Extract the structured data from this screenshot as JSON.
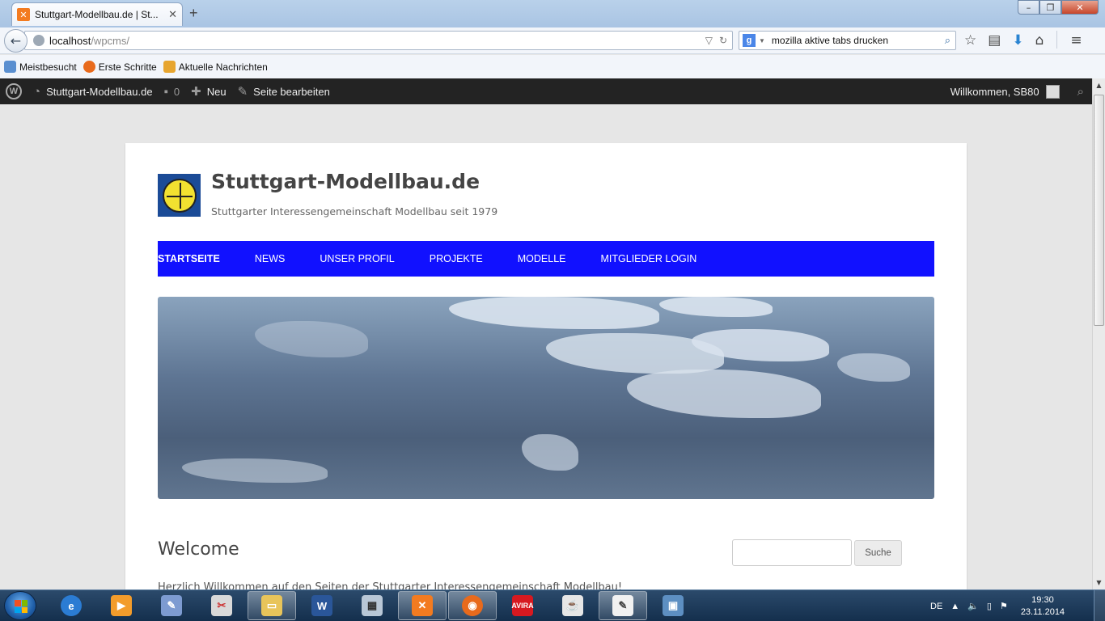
{
  "browser": {
    "tab_title": "Stuttgart-Modellbau.de | St...",
    "tab_favicon": "xampp-icon",
    "url_host": "localhost",
    "url_path": "/wpcms/",
    "search_engine": "google-icon",
    "search_text": "mozilla aktive tabs drucken",
    "bookmarks": [
      "Meistbesucht",
      "Erste Schritte",
      "Aktuelle Nachrichten"
    ]
  },
  "adminbar": {
    "site_name": "Stuttgart-Modellbau.de",
    "comments_count": "0",
    "new_label": "Neu",
    "edit_label": "Seite bearbeiten",
    "welcome": "Willkommen, SB80"
  },
  "site": {
    "title": "Stuttgart-Modellbau.de",
    "description": "Stuttgarter Interessengemeinschaft Modellbau seit 1979",
    "nav_color": "#1111ff",
    "nav": [
      "STARTSEITE",
      "NEWS",
      "UNSER PROFIL",
      "PROJEKTE",
      "MODELLE",
      "MITGLIEDER LOGIN"
    ],
    "welcome_heading": "Welcome",
    "intro_text": "Herzlich Willkommen auf den Seiten der Stuttgarter Interessengemeinschaft Modellbau!",
    "search_button": "Suche"
  },
  "taskbar": {
    "language": "DE",
    "time": "19:30",
    "date": "23.11.2014"
  }
}
